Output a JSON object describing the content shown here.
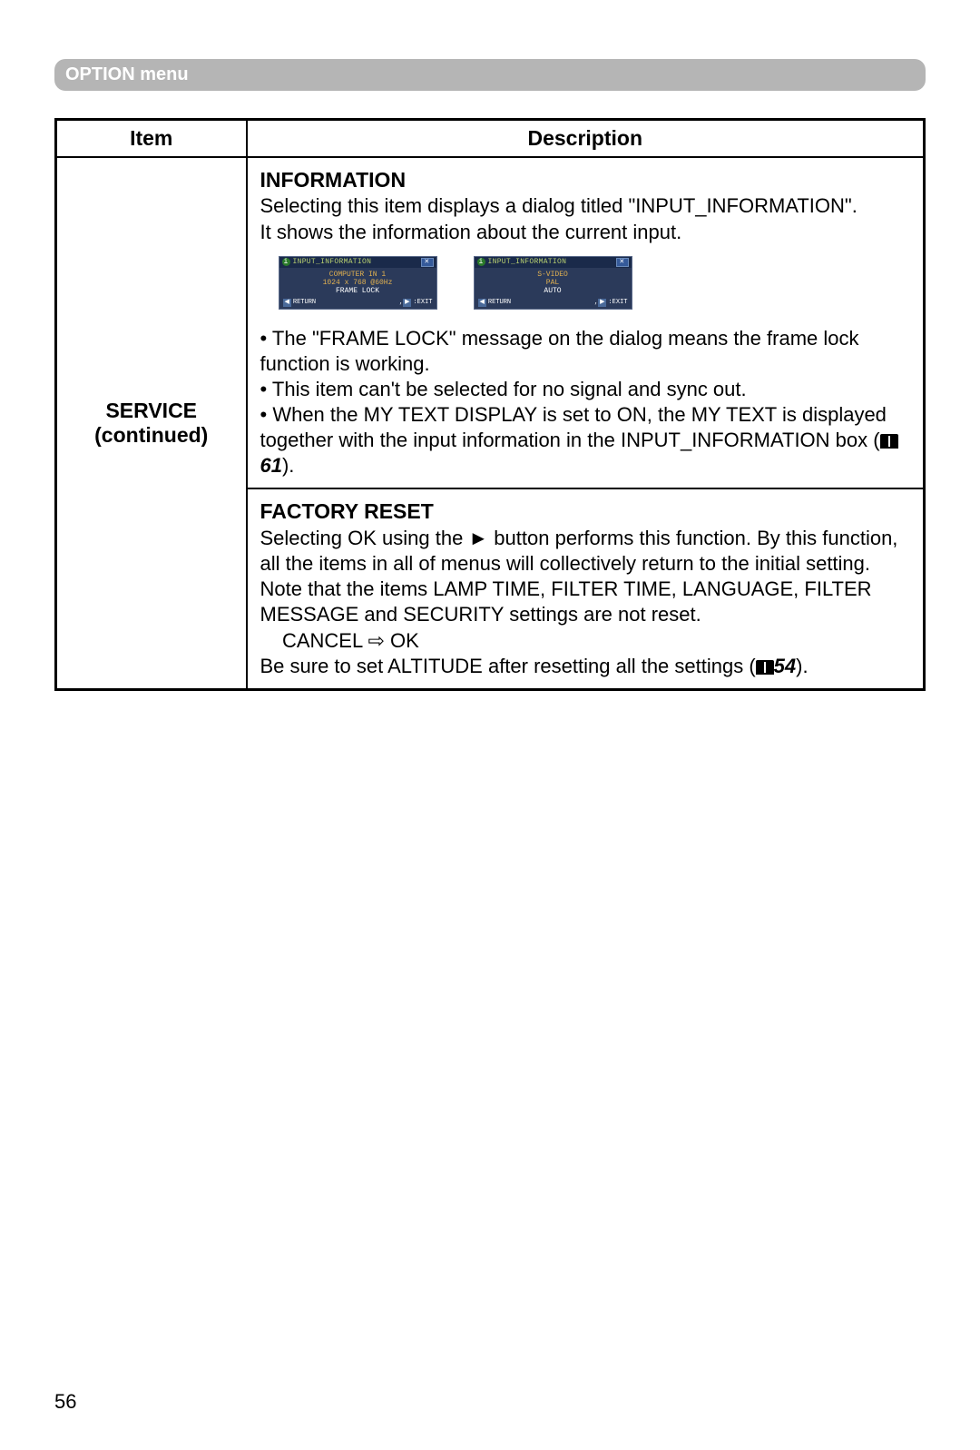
{
  "banner": "OPTION menu",
  "table": {
    "headers": {
      "item": "Item",
      "description": "Description"
    },
    "item_cell": {
      "line1": "SERVICE",
      "line2": "(continued)"
    },
    "info_section": {
      "title": "INFORMATION",
      "intro_line1": "Selecting this item displays a dialog titled \"INPUT_INFORMATION\".",
      "intro_line2": "It shows the information about the current input.",
      "bullet1": "• The \"FRAME LOCK\" message on the dialog means the frame lock function is working.",
      "bullet2": "• This item can't be selected for no signal and sync out.",
      "bullet3_pre": "• When the MY TEXT DISPLAY is set to ON, the MY TEXT is displayed together with the input information in the INPUT_INFORMATION box (",
      "bullet3_ref": "61",
      "bullet3_post": ")."
    },
    "factory_section": {
      "title": "FACTORY RESET",
      "para": "Selecting OK using the ► button performs this function. By this function, all the items in all of menus will collectively return to the initial setting. Note that the items LAMP TIME, FILTER TIME, LANGUAGE, FILTER MESSAGE and SECURITY settings are not reset.",
      "cancel_ok": "    CANCEL ⇨ OK",
      "note_pre": "Be sure to set ALTITUDE after resetting all the settings (",
      "note_ref": "54",
      "note_post": ")."
    }
  },
  "dialogs": {
    "title": "INPUT_INFORMATION",
    "return_label": "RETURN",
    "exit_label": ":EXIT",
    "left": {
      "line1": "COMPUTER IN 1",
      "line2": "1024 x 768 @60Hz",
      "line3": "FRAME LOCK"
    },
    "right": {
      "line1": "S-VIDEO",
      "line2": "PAL",
      "line3": "AUTO"
    }
  },
  "page_number": "56"
}
